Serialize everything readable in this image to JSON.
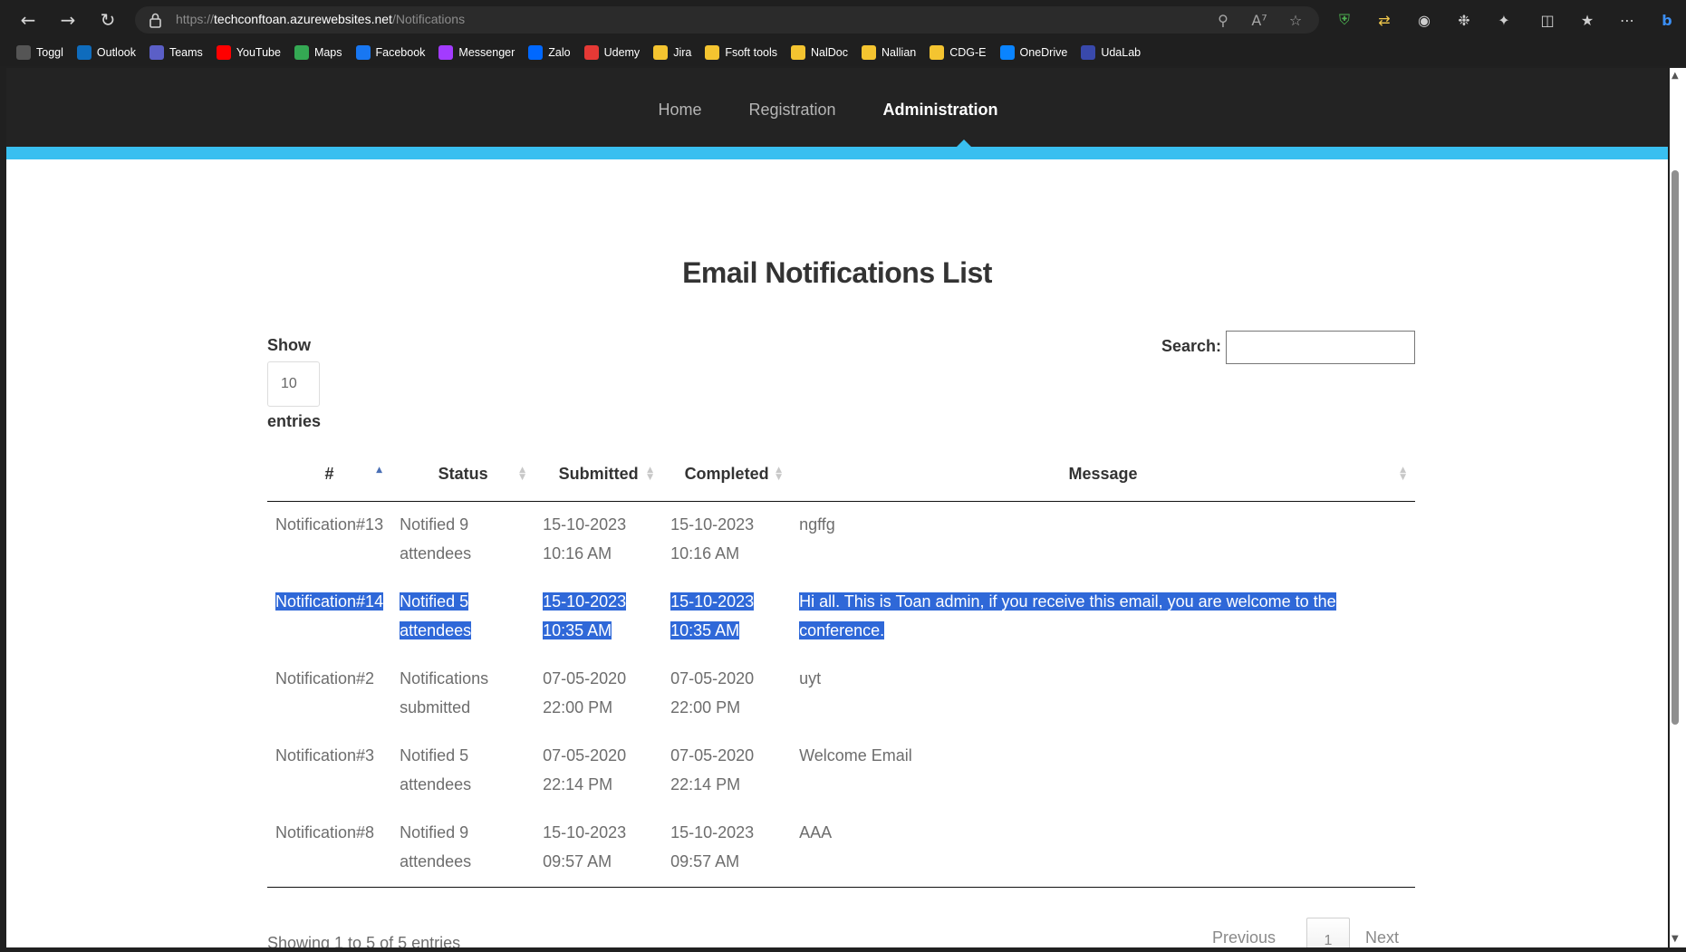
{
  "browser": {
    "url_scheme": "https://",
    "url_host": "techconftoan.azurewebsites.net",
    "url_path": "/Notifications",
    "bookmarks": [
      {
        "label": "Toggl",
        "icon": "toggl-icon",
        "color": "#555555"
      },
      {
        "label": "Outlook",
        "icon": "outlook-icon",
        "color": "#0f6cbd"
      },
      {
        "label": "Teams",
        "icon": "teams-icon",
        "color": "#5b5fc7"
      },
      {
        "label": "YouTube",
        "icon": "youtube-icon",
        "color": "#ff0000"
      },
      {
        "label": "Maps",
        "icon": "maps-icon",
        "color": "#34a853"
      },
      {
        "label": "Facebook",
        "icon": "facebook-icon",
        "color": "#1877f2"
      },
      {
        "label": "Messenger",
        "icon": "messenger-icon",
        "color": "#a33bff"
      },
      {
        "label": "Zalo",
        "icon": "zalo-icon",
        "color": "#0068ff"
      },
      {
        "label": "Udemy",
        "icon": "udemy-icon",
        "color": "#e53935"
      },
      {
        "label": "Jira",
        "icon": "folder-icon",
        "color": "#f4c430"
      },
      {
        "label": "Fsoft tools",
        "icon": "folder-icon",
        "color": "#f4c430"
      },
      {
        "label": "NalDoc",
        "icon": "folder-icon",
        "color": "#f4c430"
      },
      {
        "label": "Nallian",
        "icon": "folder-icon",
        "color": "#f4c430"
      },
      {
        "label": "CDG-E",
        "icon": "folder-icon",
        "color": "#f4c430"
      },
      {
        "label": "OneDrive",
        "icon": "onedrive-icon",
        "color": "#0a84ff"
      },
      {
        "label": "UdaLab",
        "icon": "udalab-icon",
        "color": "#3949ab"
      }
    ]
  },
  "nav": {
    "home": "Home",
    "registration": "Registration",
    "administration": "Administration"
  },
  "page": {
    "title": "Email Notifications List",
    "show_label": "Show",
    "entries_value": "10",
    "entries_label": "entries",
    "search_label": "Search:",
    "search_value": ""
  },
  "table": {
    "headers": [
      "#",
      "Status",
      "Submitted",
      "Completed",
      "Message"
    ],
    "rows": [
      {
        "id": "Notification#13",
        "status": "Notified 9 attendees",
        "submitted": "15-10-2023 10:16 AM",
        "completed": "15-10-2023 10:16 AM",
        "message": "ngffg",
        "selected": false
      },
      {
        "id": "Notification#14",
        "status": "Notified 5 attendees",
        "submitted": "15-10-2023 10:35 AM",
        "completed": "15-10-2023 10:35 AM",
        "message": "Hi all. This is Toan admin, if you receive this email, you are welcome to the conference.",
        "selected": true
      },
      {
        "id": "Notification#2",
        "status": "Notifications submitted",
        "submitted": "07-05-2020 22:00 PM",
        "completed": "07-05-2020 22:00 PM",
        "message": "uyt",
        "selected": false
      },
      {
        "id": "Notification#3",
        "status": "Notified 5 attendees",
        "submitted": "07-05-2020 22:14 PM",
        "completed": "07-05-2020 22:14 PM",
        "message": "Welcome Email",
        "selected": false
      },
      {
        "id": "Notification#8",
        "status": "Notified 9 attendees",
        "submitted": "15-10-2023 09:57 AM",
        "completed": "15-10-2023 09:57 AM",
        "message": "AAA",
        "selected": false
      }
    ]
  },
  "footer": {
    "info": "Showing 1 to 5 of 5 entries",
    "previous": "Previous",
    "current_page": "1",
    "next": "Next"
  },
  "colors": {
    "accent": "#39bff0",
    "selection": "#2f68d8",
    "navbar": "#232323"
  }
}
